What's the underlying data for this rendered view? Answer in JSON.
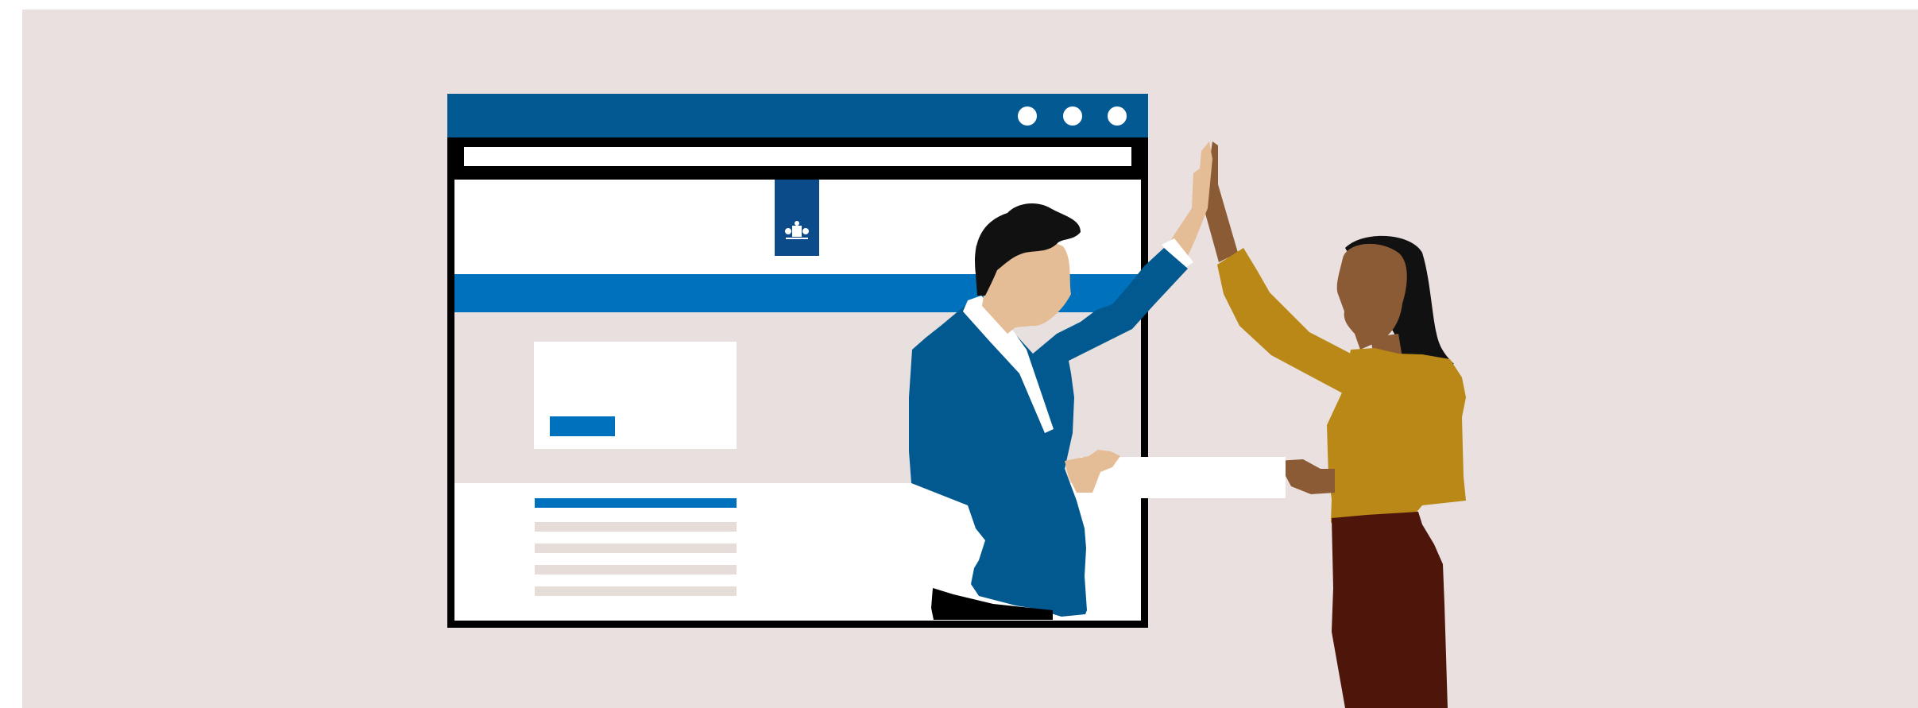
{
  "colors": {
    "background": "#e9e0df",
    "browser_titlebar": "#035a93",
    "brand_blue": "#0b4b89",
    "nav_blue": "#0071bc",
    "content_gray": "#e8e0de",
    "line_gray": "#e6dcd8",
    "man_suit": "#02598f",
    "man_skin": "#e4bc95",
    "woman_skin": "#8b5b35",
    "woman_top": "#b98816",
    "woman_skirt": "#4e160b",
    "hair": "#111111"
  },
  "icons": {
    "window_controls": [
      "circle-icon",
      "circle-icon",
      "circle-icon"
    ],
    "logo": "royal-coat-of-arms-icon"
  }
}
